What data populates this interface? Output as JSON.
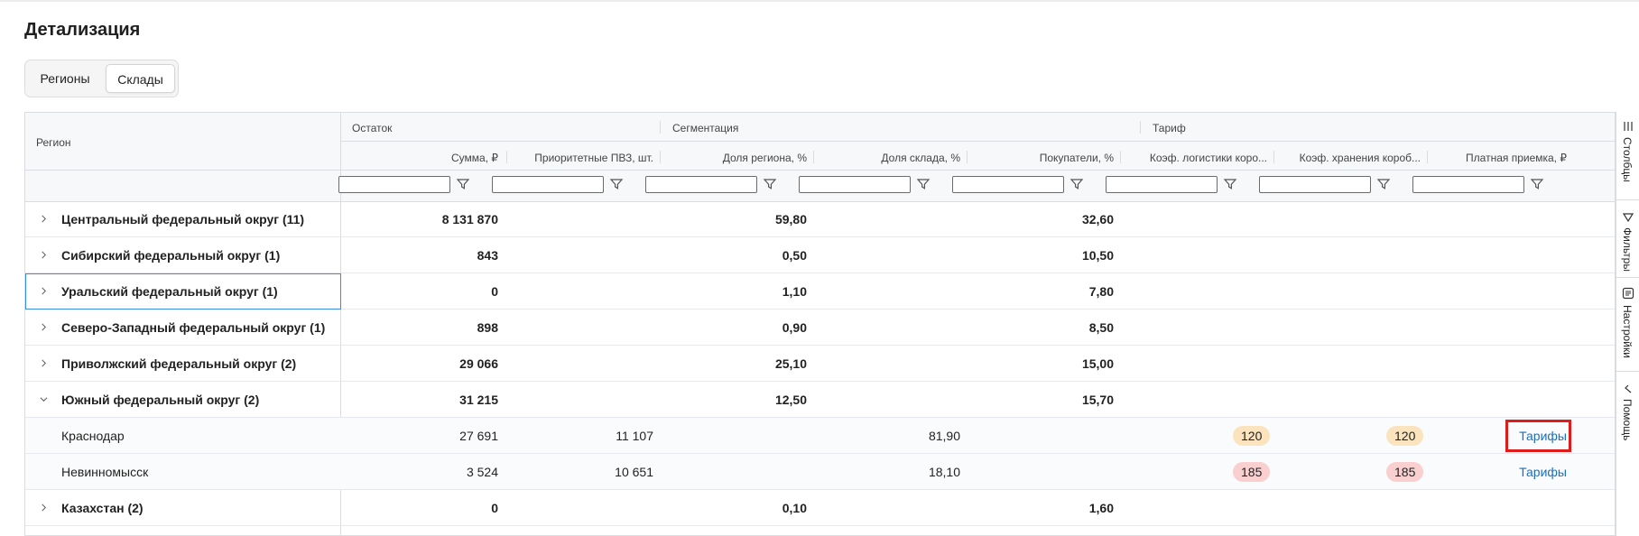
{
  "page": {
    "title": "Детализация"
  },
  "segmented": {
    "tab_regions": "Регионы",
    "tab_warehouses": "Склады"
  },
  "table": {
    "region_header": "Регион",
    "groups": {
      "ostatok": "Остаток",
      "segmentation": "Сегментация",
      "tariff": "Тариф"
    },
    "columns": {
      "sum": "Сумма, ₽",
      "priority_pvz": "Приоритетные ПВЗ, шт.",
      "region_share": "Доля региона, %",
      "warehouse_share": "Доля склада, %",
      "buyers": "Покупатели, %",
      "logistics_coef": "Коэф. логистики коро...",
      "storage_coef": "Коэф. хранения короб...",
      "paid_acceptance": "Платная приемка, ₽"
    },
    "rows": [
      {
        "name": "Центральный федеральный округ (11)",
        "sum": "8 131 870",
        "region_share": "59,80",
        "buyers": "32,60"
      },
      {
        "name": "Сибирский федеральный округ (1)",
        "sum": "843",
        "region_share": "0,50",
        "buyers": "10,50"
      },
      {
        "name": "Уральский федеральный округ (1)",
        "sum": "0",
        "region_share": "1,10",
        "buyers": "7,80"
      },
      {
        "name": "Северо-Западный федеральный округ (1)",
        "sum": "898",
        "region_share": "0,90",
        "buyers": "8,50"
      },
      {
        "name": "Приволжский федеральный округ (2)",
        "sum": "29 066",
        "region_share": "25,10",
        "buyers": "15,00"
      },
      {
        "name": "Южный федеральный округ (2)",
        "sum": "31 215",
        "region_share": "12,50",
        "buyers": "15,70"
      },
      {
        "name": "Краснодар",
        "sum": "27 691",
        "priority_pvz": "11 107",
        "warehouse_share": "81,90",
        "logistics_coef": "120",
        "storage_coef": "120",
        "paid_acceptance": "Тарифы"
      },
      {
        "name": "Невинномысск",
        "sum": "3 524",
        "priority_pvz": "10 651",
        "warehouse_share": "18,10",
        "logistics_coef": "185",
        "storage_coef": "185",
        "paid_acceptance": "Тарифы"
      },
      {
        "name": "Казахстан (2)",
        "sum": "0",
        "region_share": "0,10",
        "buyers": "1,60"
      }
    ]
  },
  "side_panel": {
    "columns": "Столбцы",
    "filters": "Фильтры",
    "settings": "Настройки",
    "help": "Помощь"
  },
  "colors": {
    "coef_medium": "#fbe4bd",
    "coef_high": "#f9cfcf",
    "link": "#1a6fc1",
    "highlight": "#e01b1b"
  }
}
